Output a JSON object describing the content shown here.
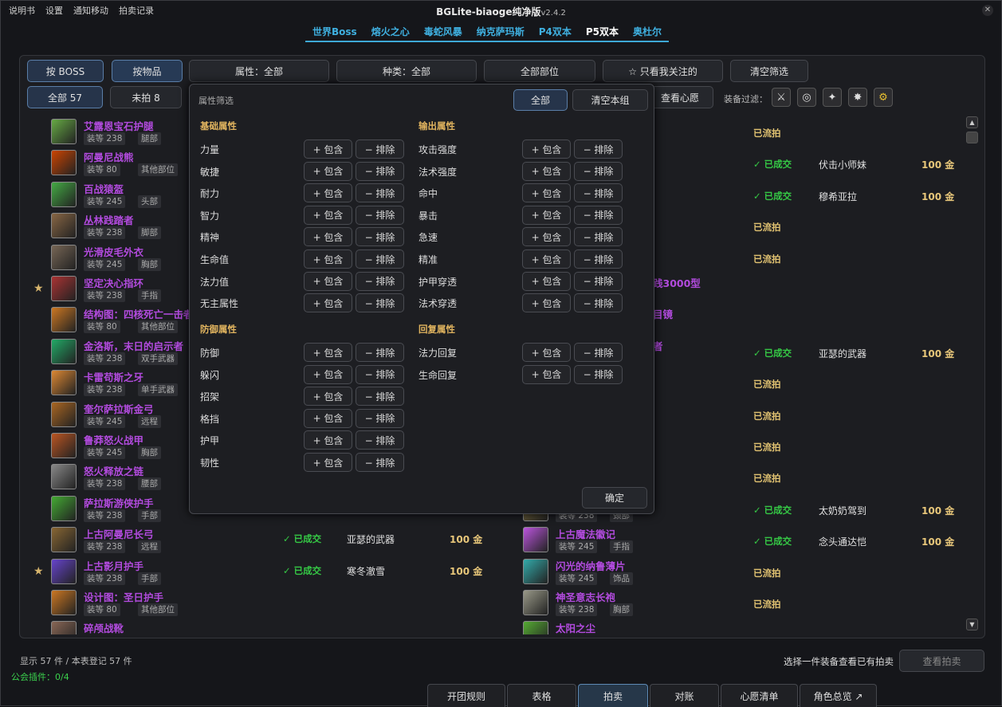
{
  "menu": [
    "说明书",
    "设置",
    "通知移动",
    "拍卖记录"
  ],
  "app_title": "BGLite-biaoge纯净版",
  "app_version": "v2.4.2",
  "raid_tabs": [
    "世界Boss",
    "熔火之心",
    "毒蛇风暴",
    "纳克萨玛斯",
    "P4双本",
    "P5双本",
    "奥杜尔"
  ],
  "active_raid_tab": "P5双本",
  "filters": {
    "by_boss": "按 BOSS",
    "by_item": "按物品",
    "attr": "属性：全部",
    "kind": "种类：全部",
    "slot": "全部部位",
    "watch": "☆ 只看我关注的",
    "clear": "清空筛选"
  },
  "subfilters": {
    "all": "全部 57",
    "unbid": "未拍 8",
    "wishlist": "查看心愿",
    "equip_filter_label": "装备过滤："
  },
  "popup": {
    "title": "属性筛选",
    "all_btn": "全部",
    "clear_btn": "清空本组",
    "confirm": "确定",
    "include": "+ 包含",
    "exclude": "− 排除",
    "groups": [
      {
        "name": "基础属性",
        "attrs": [
          "力量",
          "敏捷",
          "耐力",
          "智力",
          "精神",
          "生命值",
          "法力值",
          "无主属性"
        ]
      },
      {
        "name": "输出属性",
        "attrs": [
          "攻击强度",
          "法术强度",
          "命中",
          "暴击",
          "急速",
          "精准",
          "护甲穿透",
          "法术穿透"
        ]
      },
      {
        "name": "防御属性",
        "attrs": [
          "防御",
          "躲闪",
          "招架",
          "格挡",
          "护甲",
          "韧性"
        ]
      },
      {
        "name": "回复属性",
        "attrs": [
          "法力回复",
          "生命回复"
        ]
      }
    ]
  },
  "left_items": [
    {
      "name": "艾露恩宝石护腿",
      "ilvl": "装等 238",
      "slot": "腿部",
      "star": false,
      "color": "#6a4"
    },
    {
      "name": "阿曼尼战熊",
      "ilvl": "装等 80",
      "slot": "其他部位",
      "star": false,
      "color": "#c40"
    },
    {
      "name": "百战猿盔",
      "ilvl": "装等 245",
      "slot": "头部",
      "star": false,
      "color": "#4a4"
    },
    {
      "name": "丛林践踏者",
      "ilvl": "装等 238",
      "slot": "脚部",
      "star": false,
      "color": "#864"
    },
    {
      "name": "光滑皮毛外衣",
      "ilvl": "装等 245",
      "slot": "胸部",
      "star": false,
      "color": "#765"
    },
    {
      "name": "坚定决心指环",
      "ilvl": "装等 238",
      "slot": "手指",
      "star": true,
      "color": "#a33"
    },
    {
      "name": "结构图：四核死亡一击者",
      "ilvl": "装等 80",
      "slot": "其他部位",
      "star": false,
      "color": "#c72"
    },
    {
      "name": "金洛斯，末日的启示者",
      "ilvl": "装等 238",
      "slot": "双手武器",
      "star": false,
      "color": "#2a6"
    },
    {
      "name": "卡雷苟斯之牙",
      "ilvl": "装等 238",
      "slot": "单手武器",
      "star": false,
      "color": "#d83"
    },
    {
      "name": "奎尔萨拉斯金弓",
      "ilvl": "装等 245",
      "slot": "远程",
      "star": false,
      "color": "#a62"
    },
    {
      "name": "鲁莽怒火战甲",
      "ilvl": "装等 245",
      "slot": "胸部",
      "star": false,
      "color": "#b52"
    },
    {
      "name": "怒火释放之链",
      "ilvl": "装等 238",
      "slot": "腰部",
      "star": false,
      "color": "#888"
    },
    {
      "name": "萨拉斯游侠护手",
      "ilvl": "装等 238",
      "slot": "手部",
      "star": false,
      "color": "#4a3"
    },
    {
      "name": "上古阿曼尼长弓",
      "ilvl": "装等 238",
      "slot": "远程",
      "star": false,
      "color": "#863"
    },
    {
      "name": "上古影月护手",
      "ilvl": "装等 238",
      "slot": "手部",
      "star": true,
      "color": "#64c"
    },
    {
      "name": "设计图：圣日护手",
      "ilvl": "装等 80",
      "slot": "其他部位",
      "star": false,
      "color": "#c72"
    },
    {
      "name": "碎颅战靴",
      "ilvl": "",
      "slot": "",
      "star": false,
      "color": "#865"
    }
  ],
  "left_deals": [
    {
      "row": 13,
      "status": "已成交",
      "buyer": "亚瑟的武器",
      "price": "100 金"
    },
    {
      "row": 14,
      "status": "已成交",
      "buyer": "寒冬澈雪",
      "price": "100 金"
    }
  ],
  "right_partial": [
    {
      "row": 5,
      "text": "践3000型"
    },
    {
      "row": 6,
      "text": "目镜"
    },
    {
      "row": 7,
      "text": "者"
    }
  ],
  "right_items": [
    {
      "row": 12,
      "name": "",
      "ilvl": "装等 238",
      "slot": "颈部",
      "color": "#874"
    },
    {
      "row": 13,
      "name": "上古魔法徽记",
      "ilvl": "装等 245",
      "slot": "手指",
      "color": "#b5d"
    },
    {
      "row": 14,
      "name": "闪光的纳鲁薄片",
      "ilvl": "装等 245",
      "slot": "饰品",
      "color": "#3aa"
    },
    {
      "row": 15,
      "name": "神圣意志长袍",
      "ilvl": "装等 238",
      "slot": "胸部",
      "color": "#998"
    },
    {
      "row": 16,
      "name": "太阳之尘",
      "ilvl": "",
      "slot": "",
      "color": "#5a3"
    }
  ],
  "right_status": [
    {
      "row": 0,
      "type": "lost",
      "status": "已流拍"
    },
    {
      "row": 1,
      "type": "deal",
      "status": "已成交",
      "buyer": "伏击小师妹",
      "price": "100 金"
    },
    {
      "row": 2,
      "type": "deal",
      "status": "已成交",
      "buyer": "穆希亚拉",
      "price": "100 金"
    },
    {
      "row": 3,
      "type": "lost",
      "status": "已流拍"
    },
    {
      "row": 4,
      "type": "lost",
      "status": "已流拍"
    },
    {
      "row": 7,
      "type": "deal",
      "status": "已成交",
      "buyer": "亚瑟的武器",
      "price": "100 金"
    },
    {
      "row": 8,
      "type": "lost",
      "status": "已流拍"
    },
    {
      "row": 9,
      "type": "lost",
      "status": "已流拍"
    },
    {
      "row": 10,
      "type": "lost",
      "status": "已流拍"
    },
    {
      "row": 11,
      "type": "lost",
      "status": "已流拍"
    },
    {
      "row": 12,
      "type": "deal",
      "status": "已成交",
      "buyer": "太奶奶驾到",
      "price": "100 金"
    },
    {
      "row": 13,
      "type": "deal",
      "status": "已成交",
      "buyer": "念头通达恺",
      "price": "100 金"
    },
    {
      "row": 14,
      "type": "lost",
      "status": "已流拍"
    },
    {
      "row": 15,
      "type": "lost",
      "status": "已流拍"
    }
  ],
  "footer": {
    "count": "显示 57 件 / 本表登记 57 件",
    "guild": "公会插件：0/4",
    "hint": "选择一件装备查看已有拍卖",
    "view_btn": "查看拍卖"
  },
  "bottom_tabs": [
    "开团规则",
    "表格",
    "拍卖",
    "对账",
    "心愿清单",
    "角色总览 ↗"
  ],
  "active_bottom_tab": "拍卖"
}
